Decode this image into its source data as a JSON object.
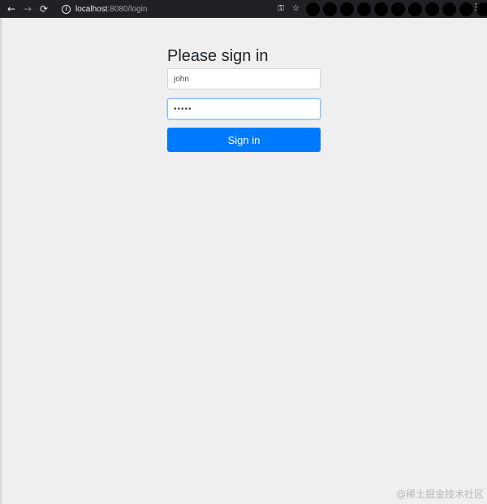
{
  "browser": {
    "nav": {
      "back_glyph": "←",
      "forward_glyph": "→",
      "reload_glyph": "⟳"
    },
    "url": {
      "host": "localhost",
      "rest": ":8080/login"
    },
    "info_glyph": "i",
    "key_glyph": "⚿",
    "star_glyph": "☆",
    "menu_glyph": "⋮",
    "extension_count": 11
  },
  "form": {
    "title": "Please sign in",
    "username_value": "john",
    "password_value": "•••••",
    "submit_label": "Sign in"
  },
  "watermark": "@稀土掘金技术社区",
  "colors": {
    "chrome_bg": "#202124",
    "page_bg": "#efefef",
    "primary": "#007bff",
    "focus_border": "#80bdff"
  }
}
